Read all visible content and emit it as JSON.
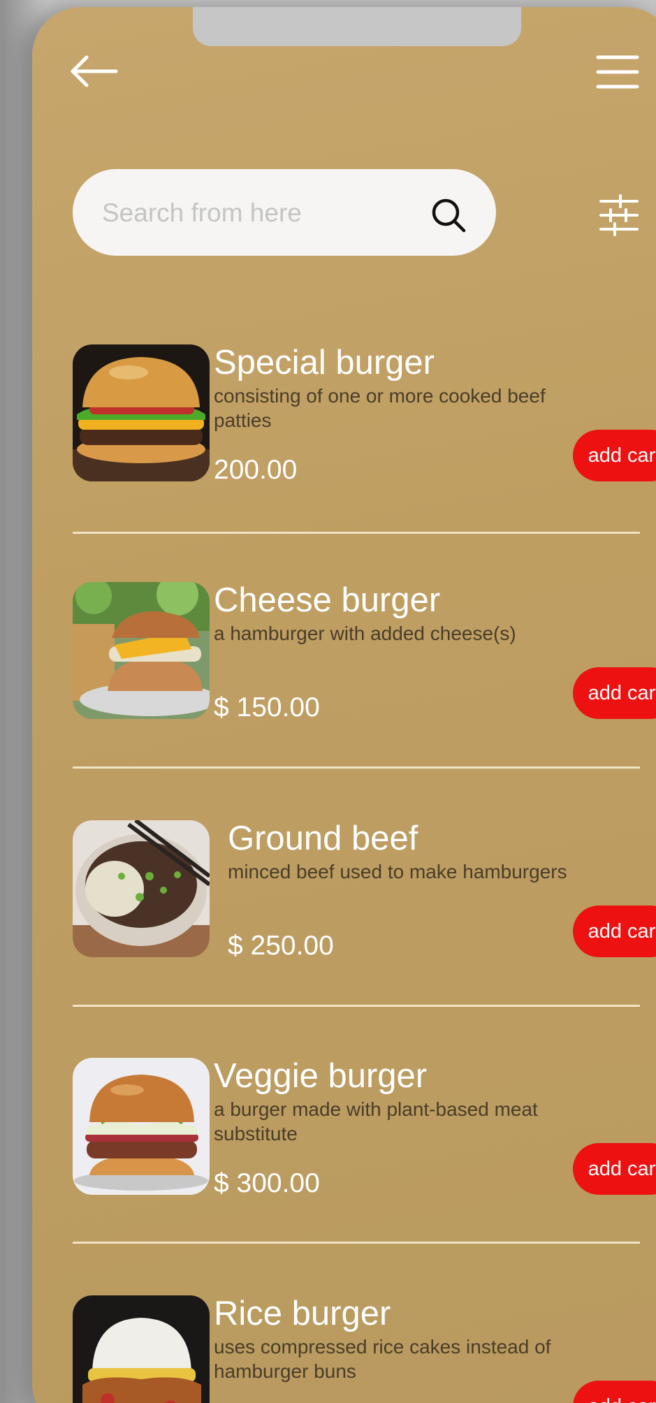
{
  "header": {
    "back_icon": "arrow-left-icon",
    "menu_icon": "hamburger-menu-icon"
  },
  "search": {
    "placeholder": "Search from here",
    "value": "",
    "icon": "search-icon"
  },
  "filter": {
    "icon": "sliders-filter-icon"
  },
  "colors": {
    "background": "#bf9e62",
    "accent": "#ee1111",
    "divider": "#f0e3c6"
  },
  "products": [
    {
      "name": "Special burger",
      "description": "consisting of one or more cooked beef patties",
      "price": " 200.00",
      "button": "add cart",
      "image": "special-burger-image"
    },
    {
      "name": "Cheese burger",
      "description": "a hamburger with added cheese(s)",
      "price": "$ 150.00",
      "button": "add cart",
      "image": "cheese-burger-image"
    },
    {
      "name": "Ground beef",
      "description": "minced beef used to make hamburgers",
      "price": "$ 250.00",
      "button": "add cart",
      "image": "ground-beef-image"
    },
    {
      "name": "Veggie burger",
      "description": "a burger made with plant-based meat substitute",
      "price": "$ 300.00",
      "button": "add cart",
      "image": "veggie-burger-image"
    },
    {
      "name": "Rice burger",
      "description": "uses compressed rice cakes instead of hamburger buns",
      "price": "",
      "button": "add cart",
      "image": "rice-burger-image"
    }
  ]
}
